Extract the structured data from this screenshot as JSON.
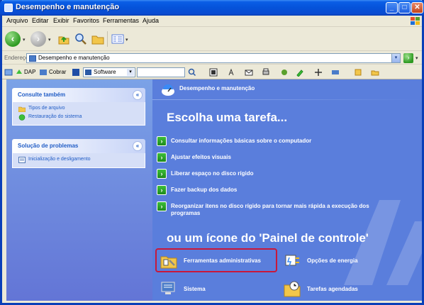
{
  "window": {
    "title": "Desempenho e manutenção",
    "controls": {
      "minimize": "_",
      "maximize": "□",
      "close": "✕"
    }
  },
  "menubar": {
    "items": [
      "Arquivo",
      "Editar",
      "Exibir",
      "Favoritos",
      "Ferramentas",
      "Ajuda"
    ]
  },
  "toolbar": {
    "back": "‹",
    "forward": "›",
    "dropdown": "▾"
  },
  "address": {
    "label": "Endereço",
    "value": "Desempenho e manutenção",
    "dropdown": "▾",
    "go": "›"
  },
  "linksbar": {
    "dap_label": "DAP",
    "cobrar_label": "Cobrar",
    "software_value": "Software"
  },
  "left": {
    "panel1": {
      "title": "Consulte também",
      "items": [
        "Tipos de arquivo",
        "Restauração do sistema"
      ]
    },
    "panel2": {
      "title": "Solução de problemas",
      "items": [
        "Inicialização e desligamento"
      ]
    }
  },
  "main": {
    "header": "Desempenho e manutenção",
    "heading1": "Escolha uma tarefa...",
    "tasks": [
      "Consultar informações básicas sobre o computador",
      "Ajustar efeitos visuais",
      "Liberar espaço no disco rígido",
      "Fazer backup dos dados",
      "Reorganizar itens no disco rígido para tornar mais rápida a execução dos",
      "programas"
    ],
    "heading2": "ou um ícone do 'Painel de controle'",
    "icons": [
      {
        "label": "Ferramentas administrativas",
        "icon": "admin-tools-icon"
      },
      {
        "label": "Opções de energia",
        "icon": "power-options-icon"
      },
      {
        "label": "Sistema",
        "icon": "system-icon"
      },
      {
        "label": "Tarefas agendadas",
        "icon": "scheduled-tasks-icon"
      }
    ]
  },
  "colors": {
    "titlebar": "#0552d9",
    "content_bg": "#5a7edc",
    "highlight": "#c8183a",
    "task_icon": "#1e8a1c"
  }
}
